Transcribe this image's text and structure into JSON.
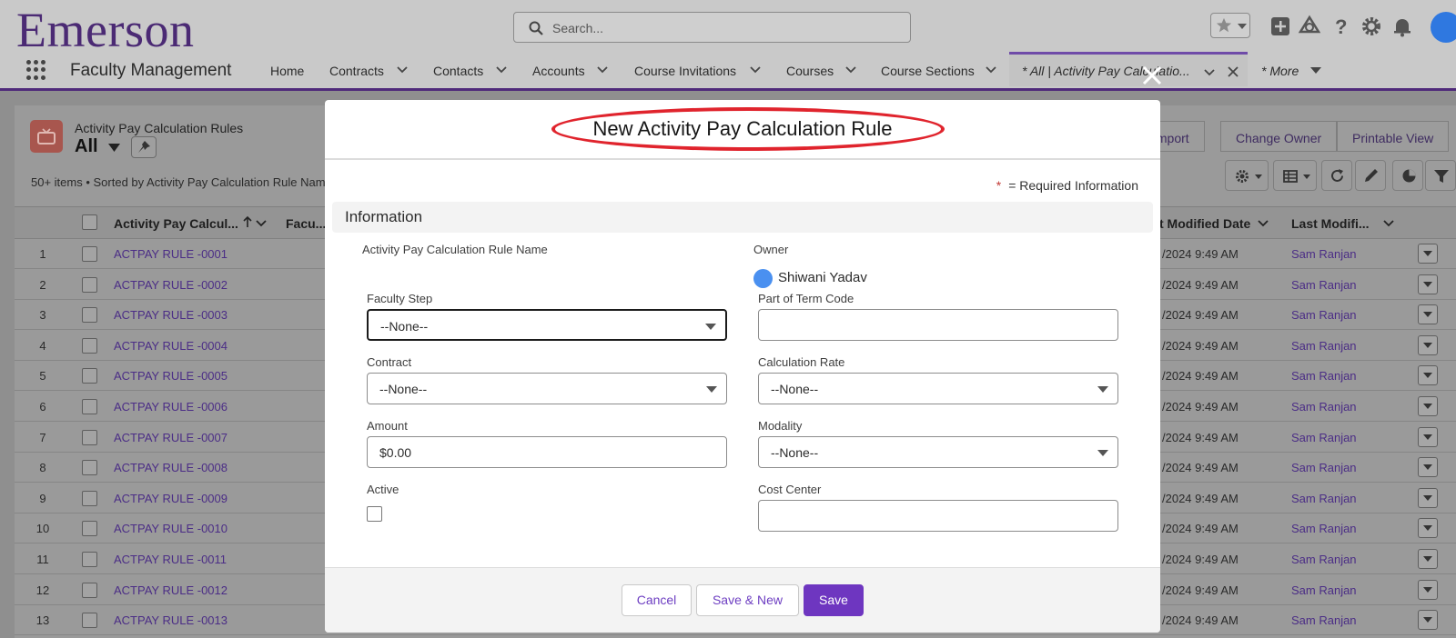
{
  "brand": {
    "logo_text": "Emerson"
  },
  "header": {
    "search_placeholder": "Search...",
    "app_name": "Faculty Management",
    "nav": [
      {
        "label": "Home",
        "has_menu": false
      },
      {
        "label": "Contracts",
        "has_menu": true
      },
      {
        "label": "Contacts",
        "has_menu": true
      },
      {
        "label": "Accounts",
        "has_menu": true
      },
      {
        "label": "Course Invitations",
        "has_menu": true
      },
      {
        "label": "Courses",
        "has_menu": true
      },
      {
        "label": "Course Sections",
        "has_menu": true
      }
    ],
    "active_tab_label": "* All | Activity Pay Calculatio...",
    "more_label": "* More"
  },
  "list": {
    "object_label": "Activity Pay Calculation Rules",
    "view_name": "All",
    "info": "50+ items • Sorted by Activity Pay Calculation Rule Nam",
    "buttons": {
      "import": "Import",
      "change_owner": "Change Owner",
      "printable": "Printable View"
    },
    "columns": {
      "name": "Activity Pay Calcul...",
      "faculty": "Facu...",
      "modified_date": "t Modified Date",
      "modified_by": "Last Modifi..."
    },
    "rows": [
      {
        "num": "1",
        "name": "ACTPAY RULE -0001",
        "date": "/2024 9:49 AM",
        "user": "Sam Ranjan"
      },
      {
        "num": "2",
        "name": "ACTPAY RULE -0002",
        "date": "/2024 9:49 AM",
        "user": "Sam Ranjan"
      },
      {
        "num": "3",
        "name": "ACTPAY RULE -0003",
        "date": "/2024 9:49 AM",
        "user": "Sam Ranjan"
      },
      {
        "num": "4",
        "name": "ACTPAY RULE -0004",
        "date": "/2024 9:49 AM",
        "user": "Sam Ranjan"
      },
      {
        "num": "5",
        "name": "ACTPAY RULE -0005",
        "date": "/2024 9:49 AM",
        "user": "Sam Ranjan"
      },
      {
        "num": "6",
        "name": "ACTPAY RULE -0006",
        "date": "/2024 9:49 AM",
        "user": "Sam Ranjan"
      },
      {
        "num": "7",
        "name": "ACTPAY RULE -0007",
        "date": "/2024 9:49 AM",
        "user": "Sam Ranjan"
      },
      {
        "num": "8",
        "name": "ACTPAY RULE -0008",
        "date": "/2024 9:49 AM",
        "user": "Sam Ranjan"
      },
      {
        "num": "9",
        "name": "ACTPAY RULE -0009",
        "date": "/2024 9:49 AM",
        "user": "Sam Ranjan"
      },
      {
        "num": "10",
        "name": "ACTPAY RULE -0010",
        "date": "/2024 9:49 AM",
        "user": "Sam Ranjan"
      },
      {
        "num": "11",
        "name": "ACTPAY RULE -0011",
        "date": "/2024 9:49 AM",
        "user": "Sam Ranjan"
      },
      {
        "num": "12",
        "name": "ACTPAY RULE -0012",
        "date": "/2024 9:49 AM",
        "user": "Sam Ranjan"
      },
      {
        "num": "13",
        "name": "ACTPAY RULE -0013",
        "date": "/2024 9:49 AM",
        "user": "Sam Ranjan"
      }
    ]
  },
  "modal": {
    "title": "New Activity Pay Calculation Rule",
    "required_star": "*",
    "required_note": "= Required Information",
    "section": "Information",
    "fields": {
      "rule_name_label": "Activity Pay Calculation Rule Name",
      "owner_label": "Owner",
      "owner_value": "Shiwani Yadav",
      "faculty_step_label": "Faculty Step",
      "faculty_step_value": "--None--",
      "term_code_label": "Part of Term Code",
      "term_code_value": "",
      "contract_label": "Contract",
      "contract_value": "--None--",
      "calc_rate_label": "Calculation Rate",
      "calc_rate_value": "--None--",
      "amount_label": "Amount",
      "amount_value": "$0.00",
      "modality_label": "Modality",
      "modality_value": "--None--",
      "active_label": "Active",
      "active_checked": false,
      "cost_center_label": "Cost Center",
      "cost_center_value": ""
    },
    "buttons": {
      "cancel": "Cancel",
      "save_new": "Save & New",
      "save": "Save"
    }
  },
  "colors": {
    "brand_purple": "#4b2a74",
    "primary_button": "#6e36c0",
    "link": "#4b2d86",
    "highlight_ellipse": "#e0242d"
  }
}
